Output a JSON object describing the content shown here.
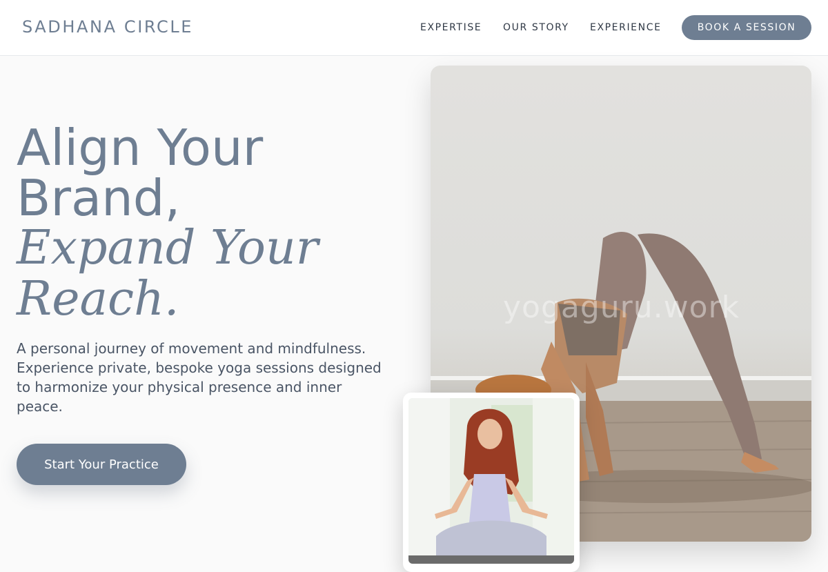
{
  "header": {
    "brand": "SADHANA CIRCLE",
    "nav": [
      "EXPERTISE",
      "OUR STORY",
      "EXPERIENCE"
    ],
    "cta": "BOOK A SESSION"
  },
  "hero": {
    "line1": "Align Your",
    "line2": "Brand,",
    "line3": "Expand Your",
    "line4": "Reach.",
    "description": "A personal journey of movement and mindfulness. Experience private, bespoke yoga sessions designed to harmonize your physical presence and inner peace.",
    "cta": "Start Your Practice"
  },
  "images": {
    "main_watermark": "yogaguru.work",
    "main_alt": "woman in downward dog pose",
    "inset_alt": "woman meditating cross-legged"
  },
  "colors": {
    "accent": "#6e7e92",
    "text": "#4a5565"
  }
}
